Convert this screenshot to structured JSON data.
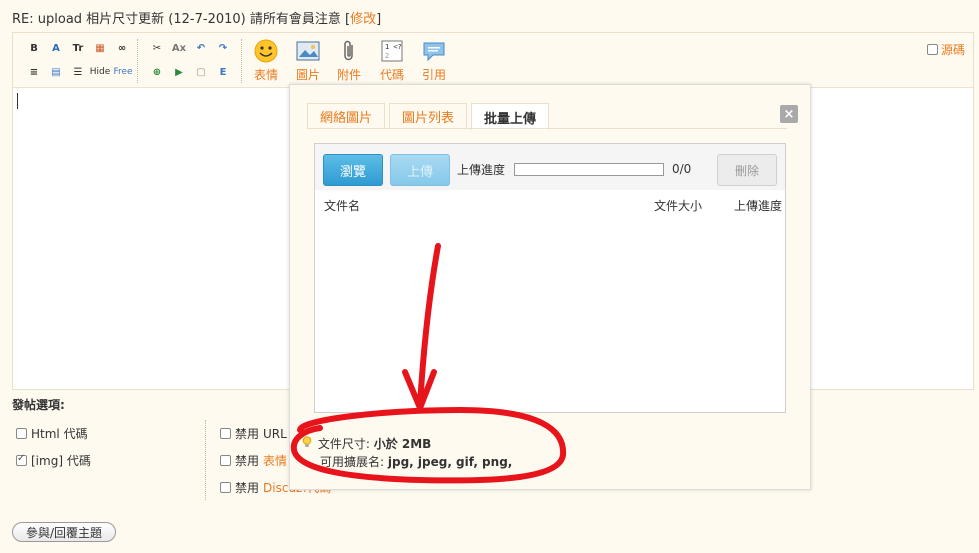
{
  "title": {
    "text": "RE: upload 相片尺寸更新 (12-7-2010) 請所有會員注意 ",
    "open_bracket": "[",
    "edit_link": "修改",
    "close_bracket": "]"
  },
  "toolbar": {
    "small_row1": [
      "B",
      "A",
      "Tr",
      "▦",
      "∞",
      "✂",
      "Ax",
      "↶",
      "↷"
    ],
    "small_row2": [
      "≡",
      "▤",
      "☰",
      "Hide",
      "Free",
      "⊕",
      "▶",
      "▢",
      "E"
    ],
    "big": [
      {
        "label": "表情",
        "icon": "smiley-icon"
      },
      {
        "label": "圖片",
        "icon": "image-icon"
      },
      {
        "label": "附件",
        "icon": "paperclip-icon"
      },
      {
        "label": "代碼",
        "icon": "code-icon"
      },
      {
        "label": "引用",
        "icon": "quote-icon"
      }
    ],
    "source_label": "源碼"
  },
  "options": {
    "title": "發帖選項:",
    "col1": [
      {
        "label": "Html 代碼",
        "checked": false
      },
      {
        "label": "[img] 代碼",
        "checked": true
      }
    ],
    "col2": [
      {
        "prefix": "禁用 ",
        "link": "URL"
      },
      {
        "prefix": "禁用 ",
        "link": "表情"
      },
      {
        "prefix": "禁用 ",
        "link": "Discuz!代碼"
      }
    ]
  },
  "submit_label": "參與/回覆主題",
  "modal": {
    "tabs": [
      {
        "label": "網絡圖片",
        "active": false
      },
      {
        "label": "圖片列表",
        "active": false
      },
      {
        "label": "批量上傳",
        "active": true
      }
    ],
    "close": "×",
    "browse": "瀏覽",
    "upload": "上傳",
    "progress_label": "上傳進度",
    "progress_value": 0,
    "progress_count": "0/0",
    "delete": "刪除",
    "columns": [
      "文件名",
      "文件大小",
      "上傳進度"
    ],
    "hint_size_label": "文件尺寸: ",
    "hint_size_value": "小於 2MB",
    "hint_ext_label": "可用擴展名: ",
    "hint_ext_value": "jpg, jpeg, gif, png,"
  },
  "colors": {
    "accent": "#e87a1e",
    "annotation": "#e8141c",
    "upload_blue": "#2f9bd2"
  }
}
